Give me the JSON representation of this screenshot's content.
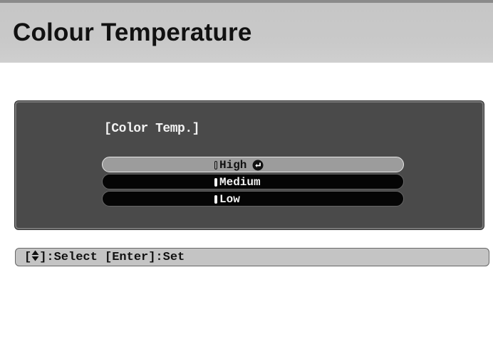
{
  "header": {
    "title": "Colour Temperature"
  },
  "menu": {
    "title": "[Color Temp.]",
    "selected": "High",
    "options": [
      {
        "label": "High",
        "selected": true,
        "current": true
      },
      {
        "label": "Medium",
        "selected": false,
        "current": false
      },
      {
        "label": "Low",
        "selected": false,
        "current": false
      }
    ]
  },
  "guide": {
    "open_bracket": "[",
    "select_text": "]:Select [Enter]:Set"
  },
  "icons": {
    "enter": "enter-return-icon",
    "updown": "up-down-arrows-icon"
  },
  "colors": {
    "header_band": "#c9c9c9",
    "panel_bg": "#4a4a4a",
    "highlight_bar": "#9c9c9c",
    "option_bar": "#050505",
    "guide_bar": "#c4c4c4"
  }
}
